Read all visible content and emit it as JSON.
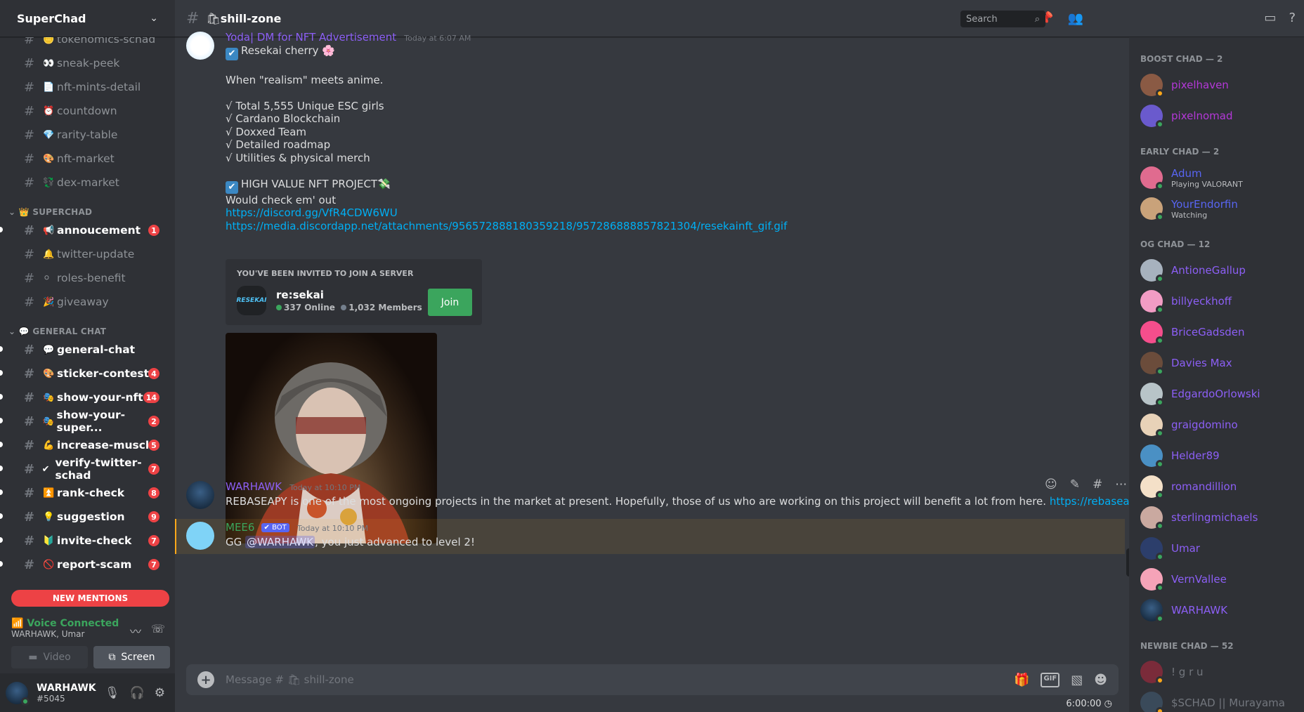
{
  "guild": {
    "name": "SuperChad"
  },
  "sidebar": {
    "channels_top": [
      {
        "emoji": "🪙",
        "label": "tokenomics-schad",
        "partial": true
      },
      {
        "emoji": "👀",
        "label": "sneak-peek"
      },
      {
        "emoji": "📄",
        "label": "nft-mints-detail"
      },
      {
        "emoji": "⏰",
        "label": "countdown"
      },
      {
        "emoji": "💎",
        "label": "rarity-table"
      },
      {
        "emoji": "🎨",
        "label": "nft-market"
      },
      {
        "emoji": "💱",
        "label": "dex-market"
      }
    ],
    "cat_superchad": "SUPERCHAD",
    "channels_superchad": [
      {
        "emoji": "📢",
        "label": "annoucement",
        "unread": true,
        "badge": "1"
      },
      {
        "emoji": "🔔",
        "label": "twitter-update"
      },
      {
        "emoji": "⚪",
        "label": "roles-benefit"
      },
      {
        "emoji": "🎉",
        "label": "giveaway"
      }
    ],
    "cat_general": "GENERAL CHAT",
    "channels_general": [
      {
        "emoji": "💬",
        "label": "general-chat",
        "unread": true
      },
      {
        "emoji": "🎨",
        "label": "sticker-contest",
        "unread": true,
        "badge": "4"
      },
      {
        "emoji": "🎭",
        "label": "show-your-nft",
        "unread": true,
        "badge": "14"
      },
      {
        "emoji": "🎭",
        "label": "show-your-super...",
        "unread": true,
        "badge": "2"
      },
      {
        "emoji": "💪",
        "label": "increase-muscle",
        "unread": true,
        "badge": "5"
      },
      {
        "emoji": "✔",
        "label": "verify-twitter-schad",
        "unread": true,
        "badge": "7"
      },
      {
        "emoji": "⏫",
        "label": "rank-check",
        "unread": true,
        "badge": "8"
      },
      {
        "emoji": "💡",
        "label": "suggestion",
        "unread": true,
        "badge": "9"
      },
      {
        "emoji": "🔰",
        "label": "invite-check",
        "unread": true,
        "badge": "7"
      },
      {
        "emoji": "🚫",
        "label": "report-scam",
        "unread": true,
        "badge": "7"
      }
    ],
    "new_mentions": "NEW MENTIONS",
    "voice": {
      "status": "Voice Connected",
      "users": "WARHAWK, Umar",
      "video_label": "Video",
      "screen_label": "Screen"
    },
    "user": {
      "name": "WARHAWK",
      "tag": "#5045"
    }
  },
  "topbar": {
    "channel": "shill-zone",
    "channel_emoji": "🛍",
    "search_placeholder": "Search"
  },
  "messages": {
    "m1": {
      "author": "Yoda| DM for NFT Advertisement",
      "timestamp": "Today at 6:07 AM",
      "lines": [
        "Resekai cherry 🌸",
        "",
        "When \"realism\" meets anime.",
        "",
        "√ Total 5,555 Unique ESC girls",
        "√ Cardano Blockchain",
        "√ Doxxed Team",
        "√ Detailed roadmap",
        "√ Utilities & physical merch",
        "",
        "HIGH VALUE NFT PROJECT💸",
        "Would check em' out"
      ],
      "link1": "https://discord.gg/VfR4CDW6WU",
      "link2": "https://media.discordapp.net/attachments/956572888180359218/957286888857821304/resekainft_gif.gif",
      "invite": {
        "header": "YOU'VE BEEN INVITED TO JOIN A SERVER",
        "icon_text": "RESEKAI",
        "server": "re:sekai",
        "online": "337 Online",
        "members": "1,032 Members",
        "join": "Join"
      }
    },
    "m2": {
      "author": "WARHAWK",
      "timestamp": "Today at 10:10 PM",
      "text": "REBASEAPY is one of the most ongoing projects in the market at present. Hopefully, those of us who are working on this project will benefit a lot from here. ",
      "link": "https://rebaseapy.com/"
    },
    "m3": {
      "author": "MEE6",
      "bot": "✔ BOT",
      "timestamp": "Today at 10:10 PM",
      "pre": "GG ",
      "mention": "@WARHAWK",
      "post": ", you just advanced to level 2!"
    }
  },
  "composer": {
    "placeholder": "Message # 🛍 shill-zone",
    "timer": "6:00:00"
  },
  "members": {
    "boost_label": "BOOST CHAD — 2",
    "boost": [
      {
        "name": "pixelhaven"
      },
      {
        "name": "pixelnomad"
      }
    ],
    "early_label": "EARLY CHAD — 2",
    "early": [
      {
        "name": "Adum",
        "sub": "Playing VALORANT"
      },
      {
        "name": "YourEndorfin",
        "sub": "Watching"
      }
    ],
    "og_label": "OG CHAD — 12",
    "og": [
      {
        "name": "AntioneGallup"
      },
      {
        "name": "billyeckhoff"
      },
      {
        "name": "BriceGadsden"
      },
      {
        "name": "Davies Max"
      },
      {
        "name": "EdgardoOrlowski"
      },
      {
        "name": "graigdomino"
      },
      {
        "name": "Helder89"
      },
      {
        "name": "romandillion"
      },
      {
        "name": "sterlingmichaels"
      },
      {
        "name": "Umar"
      },
      {
        "name": "VernVallee"
      },
      {
        "name": "WARHAWK"
      }
    ],
    "newbie_label": "NEWBIE CHAD — 52",
    "newbie": [
      {
        "name": "! g r u"
      },
      {
        "name": "$SCHAD || Murayama"
      }
    ]
  },
  "colors": {
    "accent": "#5865f2",
    "online": "#3ba55d",
    "danger": "#ed4245",
    "member_name": "#8c5ff5",
    "link": "#00aff4"
  }
}
